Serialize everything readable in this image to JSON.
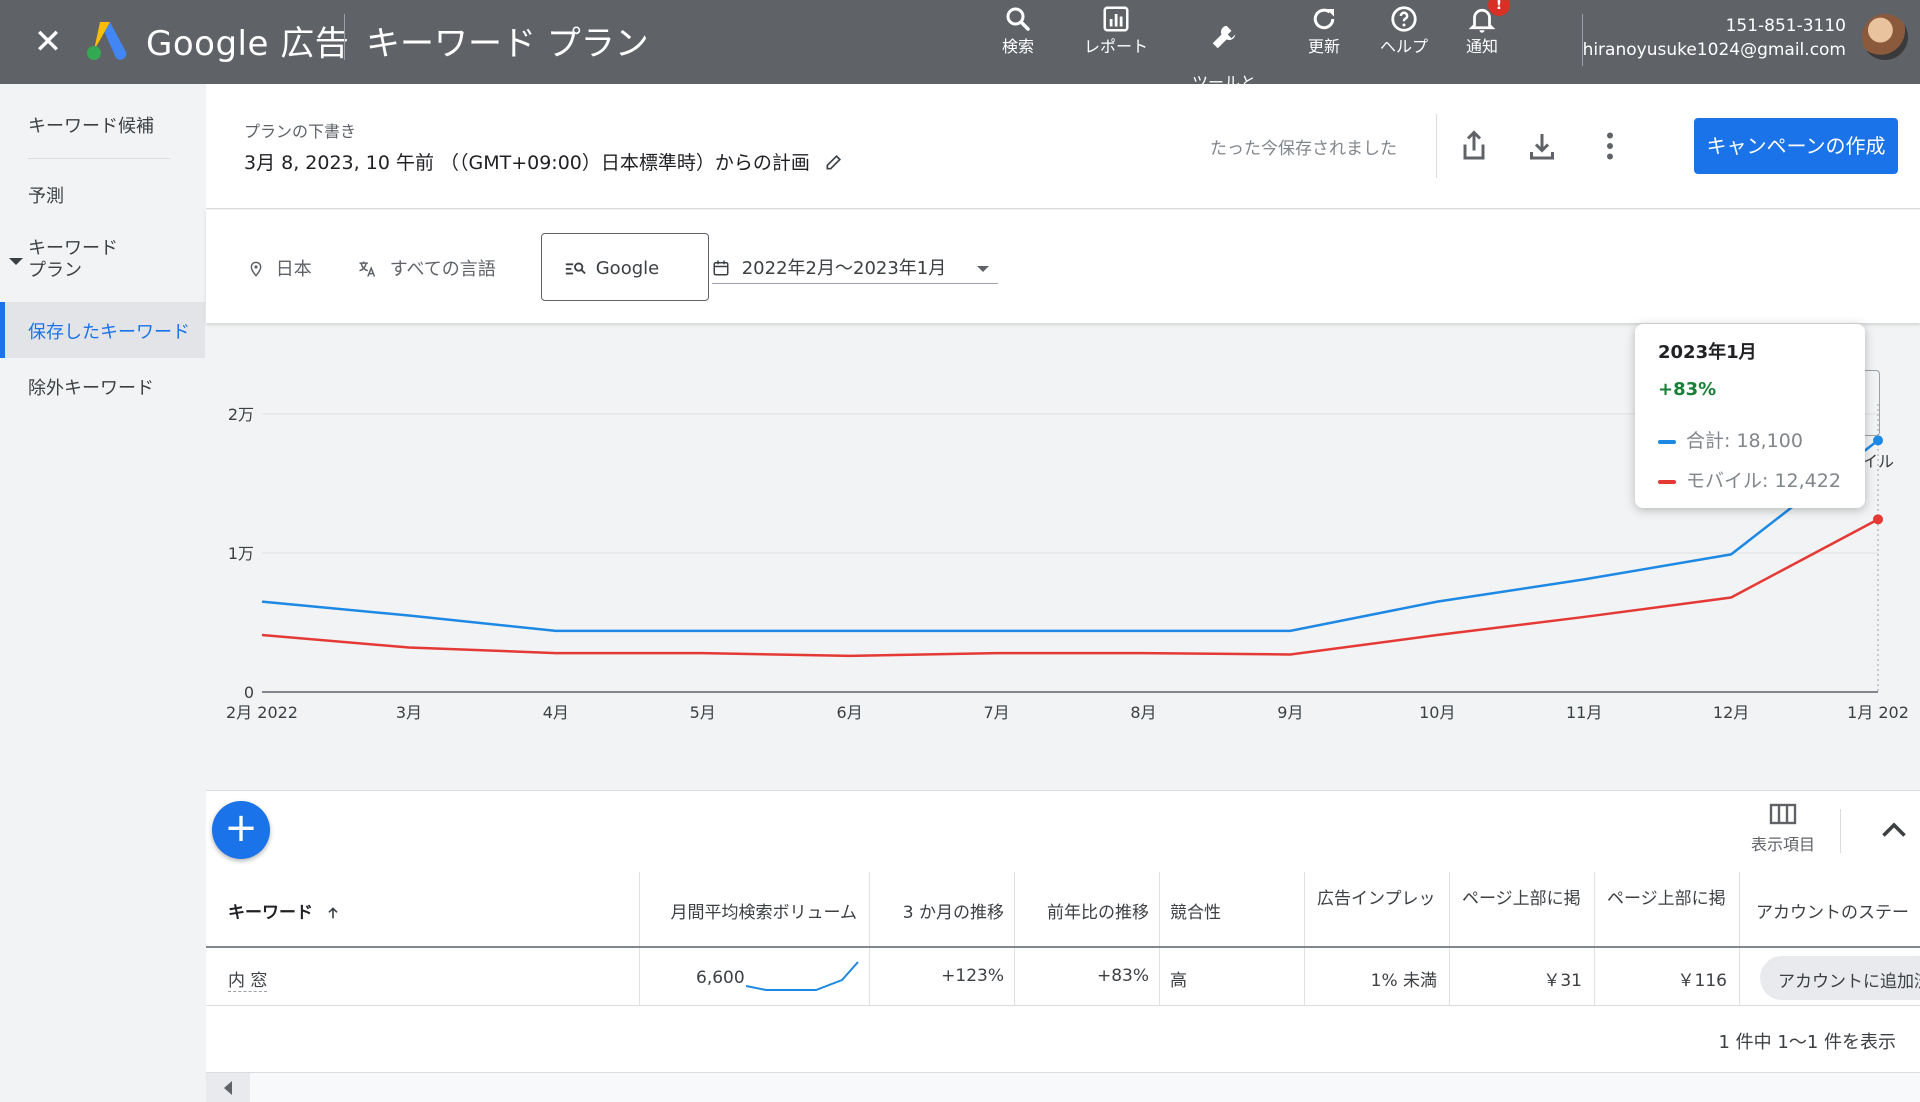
{
  "header": {
    "brand": "Google 広告",
    "title": "キーワード プラン",
    "tools": [
      {
        "label": "検索",
        "icon": "search-icon"
      },
      {
        "label": "レポート",
        "icon": "report-icon"
      },
      {
        "label": "ツールと\n設定",
        "icon": "wrench-icon"
      },
      {
        "label": "更新",
        "icon": "refresh-icon"
      },
      {
        "label": "ヘルプ",
        "icon": "help-icon"
      },
      {
        "label": "通知",
        "icon": "bell-icon"
      }
    ],
    "notification_badge": "!",
    "account_id": "151-851-3110",
    "account_email": "hiranoyusuke1024@gmail.com"
  },
  "sidebar": {
    "items": [
      {
        "label": "キーワード候補"
      },
      {
        "label": "予測"
      },
      {
        "label": "キーワード\nプラン"
      },
      {
        "label": "保存したキーワード"
      },
      {
        "label": "除外キーワード"
      }
    ]
  },
  "plan": {
    "draft_label": "プランの下書き",
    "name": "3月 8, 2023, 10 午前 （（GMT+09:00）日本標準時）からの計画",
    "saved_status": "たった今保存されました",
    "create_campaign_label": "キャンペーンの作成"
  },
  "filters": {
    "location": "日本",
    "language": "すべての言語",
    "network": "Google",
    "date_range": "2022年2月〜2023年1月"
  },
  "colors": {
    "total": "#1e88e5",
    "mobile": "#e53935",
    "accent": "#1a73e8",
    "positive": "#188038"
  },
  "chart_data": {
    "type": "line",
    "x": [
      "2月 2022",
      "3月",
      "4月",
      "5月",
      "6月",
      "7月",
      "8月",
      "9月",
      "10月",
      "11月",
      "12月",
      "1月 202"
    ],
    "series": [
      {
        "name": "合計",
        "values": [
          6500,
          5500,
          4400,
          4400,
          4400,
          4400,
          4400,
          4400,
          6500,
          8100,
          9900,
          18100
        ]
      },
      {
        "name": "モバイル",
        "values": [
          4100,
          3200,
          2800,
          2800,
          2600,
          2800,
          2800,
          2700,
          4100,
          5400,
          6800,
          12422
        ]
      }
    ],
    "y_ticks": [
      "0",
      "1万",
      "2万"
    ],
    "y_tick_values": [
      0,
      10000,
      20000
    ],
    "ylim": [
      0,
      20000
    ],
    "grid": true,
    "tooltip": {
      "title": "2023年1月",
      "change": "+83%",
      "lines": [
        "合計: 18,100",
        "モバイル: 12,422"
      ]
    },
    "legend_partial": "イル"
  },
  "table": {
    "columns_button_label": "表示項目",
    "headers": [
      "キーワード",
      "月間平均検索ボリューム",
      "3 か月の推移",
      "前年比の推移",
      "競合性",
      "広告インプレッ",
      "ページ上部に掲",
      "ページ上部に掲",
      "アカウントのステー"
    ],
    "row": {
      "keyword": "内 窓",
      "monthly_volume": "6,600",
      "three_month": "+123%",
      "yoy": "+83%",
      "competition": "高",
      "impression_share": "1% 未満",
      "top_bid_low": "￥31",
      "top_bid_high": "￥116",
      "status": "アカウントに追加済"
    },
    "pagination": "1 件中 1〜1 件を表示"
  }
}
